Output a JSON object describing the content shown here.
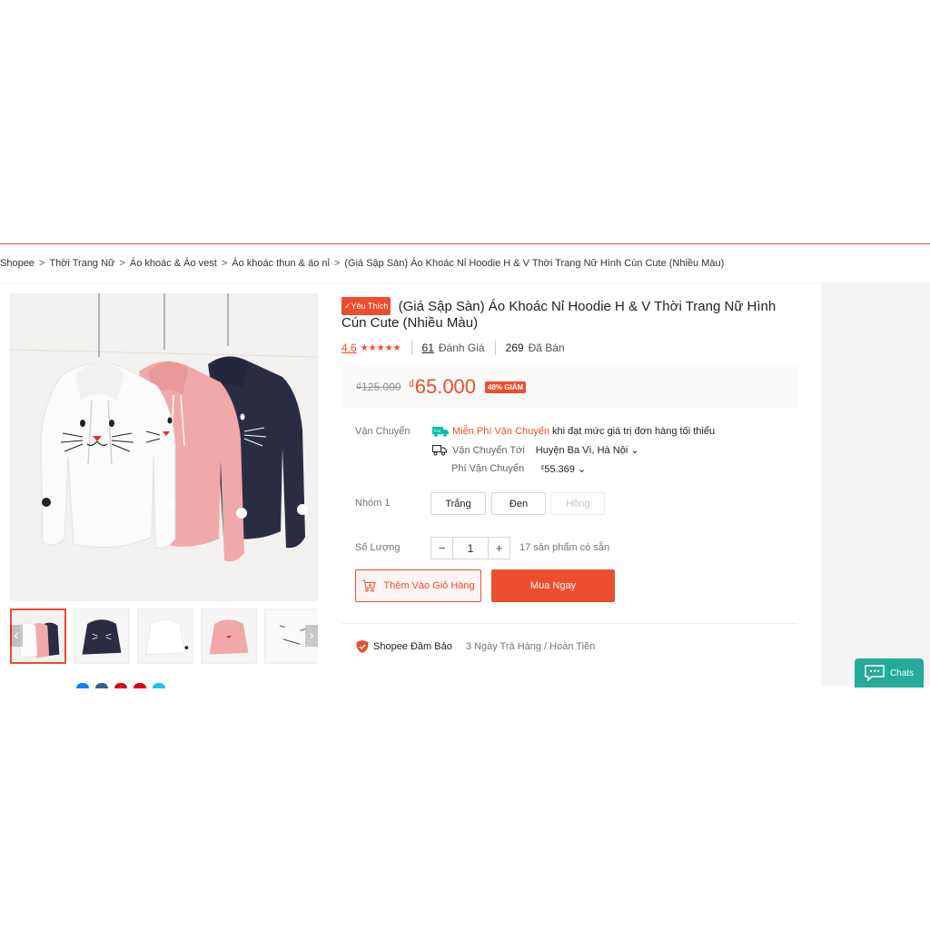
{
  "breadcrumb": {
    "items": [
      "Shopee",
      "Thời Trang Nữ",
      "Áo khoác & Áo vest",
      "Áo khoác thun & áo nỉ",
      "(Giá Sập Sàn) Áo Khoác Nỉ Hoodie H & V Thời Trang Nữ Hình Cún Cute (Nhiều Màu)"
    ],
    "separator": ">"
  },
  "product": {
    "badge": "Yêu Thích",
    "title": "(Giá Sập Sàn) Áo Khoác Nỉ Hoodie H & V Thời Trang Nữ Hình Cún Cute (Nhiều Màu)",
    "rating": "4.6",
    "stars_icon": "★★★★★",
    "reviews_count": "61",
    "reviews_label": "Đánh Giá",
    "sold_count": "269",
    "sold_label": "Đã Bán"
  },
  "price": {
    "old": "₫125.000",
    "currency": "₫",
    "new": "65.000",
    "discount": "48% GIẢM"
  },
  "shipping": {
    "label": "Vận Chuyển",
    "free_label": "Miễn Phí Vận Chuyển",
    "free_desc": "khi đạt mức giá trị đơn hàng tối thiểu",
    "to_label": "Vận Chuyển Tới",
    "to_value": "Huyện Ba Vì, Hà Nội",
    "fee_label": "Phí Vận Chuyển",
    "fee_currency": "₫",
    "fee_value": "55.369"
  },
  "variants": {
    "label": "Nhóm 1",
    "options": [
      "Trắng",
      "Đen",
      "Hồng"
    ]
  },
  "quantity": {
    "label": "Số Lượng",
    "minus": "−",
    "value": "1",
    "plus": "+",
    "stock": "17 sản phẩm có sẵn"
  },
  "actions": {
    "add_to_cart": "Thêm Vào Giỏ Hàng",
    "buy_now": "Mua Ngay"
  },
  "guarantee": {
    "title": "Shopee Đảm Bảo",
    "desc": "3 Ngày Trả Hàng / Hoàn Tiền"
  },
  "chat": {
    "label": "Chats"
  },
  "colors": {
    "accent": "#ee4d2d",
    "chat": "#26aa99"
  }
}
